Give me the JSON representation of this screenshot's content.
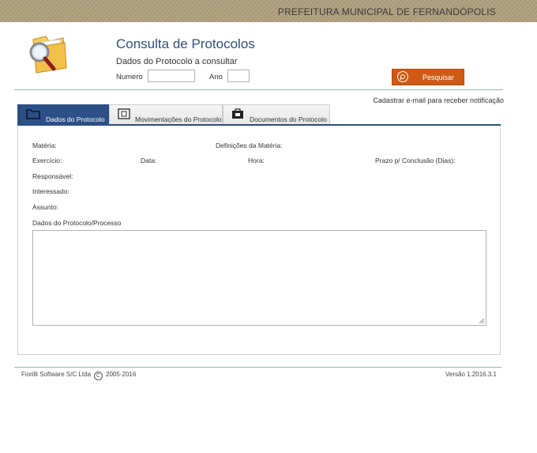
{
  "header": {
    "org_name": "PREFEITURA MUNICIPAL DE FERNANDÓPOLIS"
  },
  "page": {
    "title": "Consulta de Protocolos",
    "subtitle": "Dados do Protocolo a consultar"
  },
  "search": {
    "numero_label": "Numero",
    "numero_value": "",
    "ano_label": "Ano",
    "ano_value": "",
    "button_label": "Pesquisar"
  },
  "notify_link": "Cadastrar e-mail para receber notificação",
  "tabs": [
    {
      "label": "Dados do Protocolo",
      "icon": "folder-icon",
      "active": true
    },
    {
      "label": "Movimentações do Protocolo",
      "icon": "document-icon",
      "active": false
    },
    {
      "label": "Documentos do Protocolo",
      "icon": "briefcase-icon",
      "active": false
    }
  ],
  "fields": {
    "materia": "Matéria:",
    "definicoes": "Definições da Matéria:",
    "exercicio": "Exercício:",
    "data": "Data:",
    "hora": "Hora:",
    "prazo": "Prazo p/ Conclusão (Dias):",
    "responsavel": "Responsável:",
    "interessado": "Interessado:",
    "assunto": "Assunto:",
    "dados_processo": "Dados do Protocolo/Processo"
  },
  "footer": {
    "company": "Fiorilli Software S/C Ltda",
    "copyright_symbol": "C",
    "years": "2005-2016",
    "version": "Versão 1.2016.3.1"
  },
  "colors": {
    "accent": "#2c4f86",
    "button": "#cf5a14",
    "banner": "#ad9e7e"
  }
}
